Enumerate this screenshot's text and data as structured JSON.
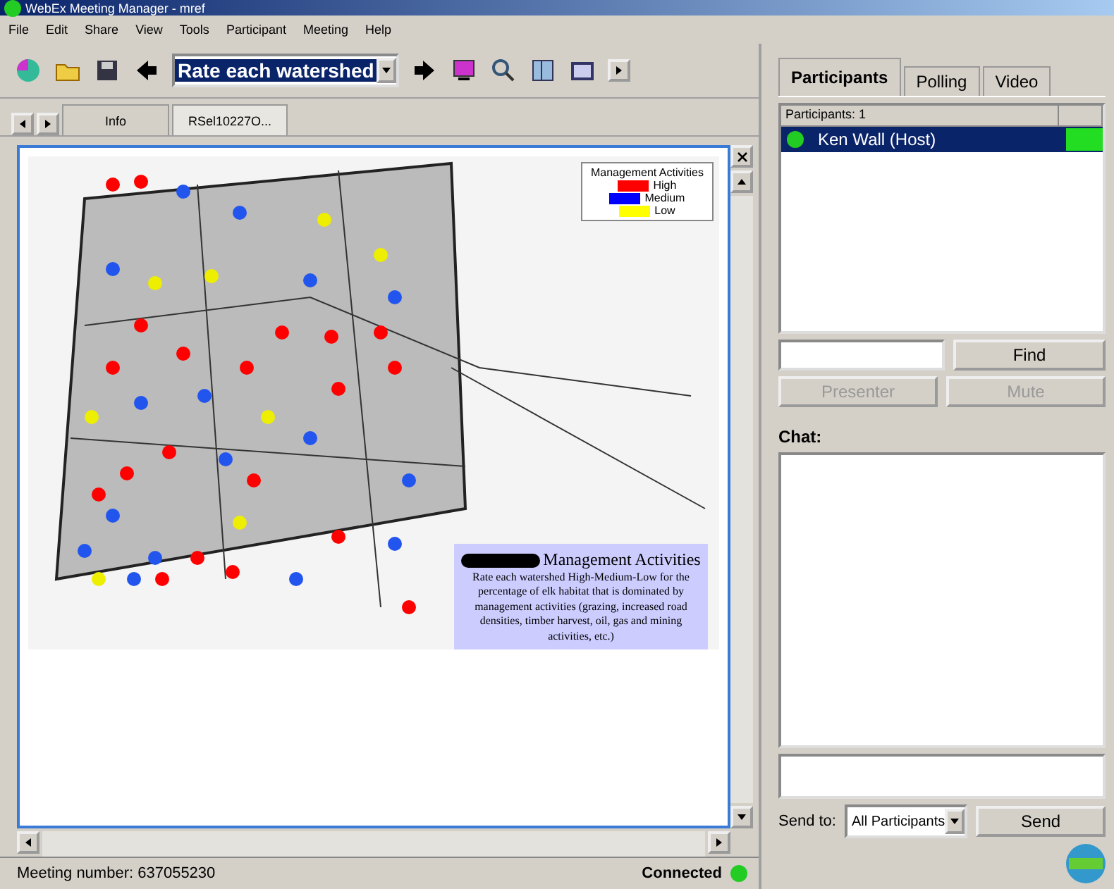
{
  "window": {
    "title": "WebEx Meeting Manager - mref"
  },
  "menu": [
    "File",
    "Edit",
    "Share",
    "View",
    "Tools",
    "Participant",
    "Meeting",
    "Help"
  ],
  "toolbar": {
    "page_select": "Rate each watershed"
  },
  "doc_tabs": [
    {
      "label": "Info",
      "selected": false
    },
    {
      "label": "RSel10227O...",
      "selected": true
    }
  ],
  "document": {
    "legend": {
      "title": "Management Activities",
      "items": [
        {
          "label": "High",
          "color": "#ff0000"
        },
        {
          "label": "Medium",
          "color": "#0000ff"
        },
        {
          "label": "Low",
          "color": "#ffff00"
        }
      ]
    },
    "caption": {
      "title": "Management Activities",
      "body": "Rate each watershed High-Medium-Low for the percentage of elk habitat that is dominated by management activities (grazing, increased road densities, timber harvest, oil, gas and mining activities, etc.)"
    }
  },
  "status_bar": {
    "meeting_number": "Meeting number: 637055230",
    "connection": "Connected"
  },
  "panel_tabs": [
    {
      "label": "Participants",
      "selected": true
    },
    {
      "label": "Polling",
      "selected": false
    },
    {
      "label": "Video",
      "selected": false
    }
  ],
  "participants": {
    "header": "Participants: 1",
    "rows": [
      {
        "name": "Ken Wall (Host)",
        "selected": true
      }
    ]
  },
  "find": {
    "button": "Find"
  },
  "actions": [
    {
      "label": "Presenter",
      "disabled": true
    },
    {
      "label": "Mute",
      "disabled": true
    }
  ],
  "chat": {
    "label": "Chat:",
    "send_to_label": "Send to:",
    "send_to": "All Participants",
    "send": "Send"
  }
}
